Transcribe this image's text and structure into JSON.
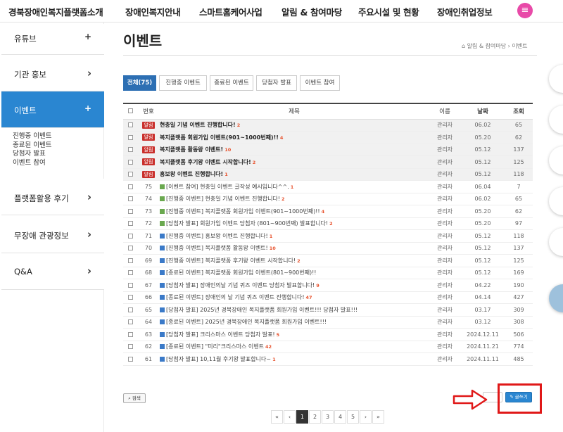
{
  "topnav": {
    "items": [
      "경북장애인복지플랫폼소개",
      "장애인복지안내",
      "스마트홈케어사업",
      "알림 & 참여마당",
      "주요시설 및 현황",
      "장애인취업정보"
    ],
    "menu_icon": "hamburger-menu-icon",
    "accent_color": "#e84aa8"
  },
  "sidebar": {
    "items": [
      {
        "label": "유튜브",
        "icon": "+"
      },
      {
        "label": "기관 홍보",
        "icon": "›"
      },
      {
        "label": "이벤트",
        "icon": "+"
      },
      {
        "label": "플랫폼활용 후기",
        "icon": "›"
      },
      {
        "label": "무장애 관광정보",
        "icon": "›"
      },
      {
        "label": "Q&A",
        "icon": "›"
      }
    ],
    "sub_items": [
      "진행중 이벤트",
      "종료된 이벤트",
      "당첨자 발표",
      "이벤트 참여"
    ],
    "active_color": "#2a86d1"
  },
  "page": {
    "title": "이벤트",
    "breadcrumb": "알림 & 참여마당 › 이벤트"
  },
  "tabs": [
    "전체(75)",
    "진행중 이벤트",
    "종료된 이벤트",
    "당첨자 발표",
    "이벤트 참여"
  ],
  "table": {
    "headers": {
      "num": "번호",
      "subject": "제목",
      "name": "이름",
      "date": "날짜",
      "views": "조회"
    },
    "notice_badge": "알림",
    "notices": [
      {
        "subject": "현충일 기념 이벤트 진행합니다!",
        "count": "2",
        "name": "관리자",
        "date": "06.02",
        "views": "65"
      },
      {
        "subject": "복지플랫폼 회원가입 이벤트(901~1000번째)!!",
        "count": "4",
        "name": "관리자",
        "date": "05.20",
        "views": "62"
      },
      {
        "subject": "복지플랫폼 활동왕 이벤트!",
        "count": "10",
        "name": "관리자",
        "date": "05.12",
        "views": "137"
      },
      {
        "subject": "복지플랫폼 후기왕 이벤트 시작합니다!",
        "count": "2",
        "name": "관리자",
        "date": "05.12",
        "views": "125"
      },
      {
        "subject": "홍보왕 이벤트 진행합니다!",
        "count": "1",
        "name": "관리자",
        "date": "05.12",
        "views": "118"
      }
    ],
    "rows": [
      {
        "num": "75",
        "icon": "img",
        "subject": "[이벤트 참여] 현충일 이벤트 글작성 예시입니다^^.",
        "count": "1",
        "name": "관리자",
        "date": "06.04",
        "views": "7"
      },
      {
        "num": "74",
        "icon": "img",
        "subject": "[진행중 이벤트] 현충일 기념 이벤트 진행합니다!",
        "count": "2",
        "name": "관리자",
        "date": "06.02",
        "views": "65"
      },
      {
        "num": "73",
        "icon": "img",
        "subject": "[진행중 이벤트] 복지플랫폼 회원가입 이벤트(901~1000번째)!!",
        "count": "4",
        "name": "관리자",
        "date": "05.20",
        "views": "62"
      },
      {
        "num": "72",
        "icon": "img",
        "subject": "[당첨자 발표] 회원가입 이벤트 당첨자 (801~900번째) 발표합니다!",
        "count": "2",
        "name": "관리자",
        "date": "05.20",
        "views": "97"
      },
      {
        "num": "71",
        "icon": "file",
        "subject": "[진행중 이벤트] 홍보왕 이벤트 진행합니다!",
        "count": "1",
        "name": "관리자",
        "date": "05.12",
        "views": "118"
      },
      {
        "num": "70",
        "icon": "file",
        "subject": "[진행중 이벤트] 복지플랫폼 활동왕 이벤트!",
        "count": "10",
        "name": "관리자",
        "date": "05.12",
        "views": "137"
      },
      {
        "num": "69",
        "icon": "file",
        "subject": "[진행중 이벤트] 복지플랫폼 후기왕 이벤트 시작합니다!",
        "count": "2",
        "name": "관리자",
        "date": "05.12",
        "views": "125"
      },
      {
        "num": "68",
        "icon": "file",
        "subject": "[종료된 이벤트] 복지플랫폼 회원가입 이벤트(801~900번째)!!",
        "count": "",
        "name": "관리자",
        "date": "05.12",
        "views": "169"
      },
      {
        "num": "67",
        "icon": "file",
        "subject": "[당첨자 발표] 장애인의날 기념 퀴즈 이벤트 당첨자 발표합니다!",
        "count": "9",
        "name": "관리자",
        "date": "04.22",
        "views": "190"
      },
      {
        "num": "66",
        "icon": "file",
        "subject": "[종료된 이벤트] 장애인의 날 기념 퀴즈 이벤트 진행합니다!",
        "count": "47",
        "name": "관리자",
        "date": "04.14",
        "views": "427"
      },
      {
        "num": "65",
        "icon": "file",
        "subject": "[당첨자 발표] 2025년 경북장애인 복지플랫폼 회원가입 이벤트!!! 당첨자 발표!!!",
        "count": "",
        "name": "관리자",
        "date": "03.17",
        "views": "309"
      },
      {
        "num": "64",
        "icon": "file",
        "subject": "[종료된 이벤트] 2025년 경북장애인 복지플랫폼 회원가입 이벤트!!!",
        "count": "",
        "name": "관리자",
        "date": "03.12",
        "views": "308"
      },
      {
        "num": "63",
        "icon": "file",
        "subject": "[당첨자 발표] 크리스마스 이벤트 당첨자 발표!",
        "count": "5",
        "name": "관리자",
        "date": "2024.12.11",
        "views": "506"
      },
      {
        "num": "62",
        "icon": "file",
        "subject": "[종료된 이벤트] \"미리\"크리스마스 이벤트",
        "count": "42",
        "name": "관리자",
        "date": "2024.11.21",
        "views": "774"
      },
      {
        "num": "61",
        "icon": "file",
        "subject": "[당첨자 발표] 10,11월 후기왕 발표합니다~",
        "count": "1",
        "name": "관리자",
        "date": "2024.11.11",
        "views": "485"
      }
    ]
  },
  "buttons": {
    "search": "검색",
    "write": "글쓰기",
    "highlight_color": "#e01818"
  },
  "pagination": {
    "first": "«",
    "prev": "‹",
    "pages": [
      "1",
      "2",
      "3",
      "4",
      "5"
    ],
    "next": "›",
    "last": "»",
    "current": "1"
  }
}
